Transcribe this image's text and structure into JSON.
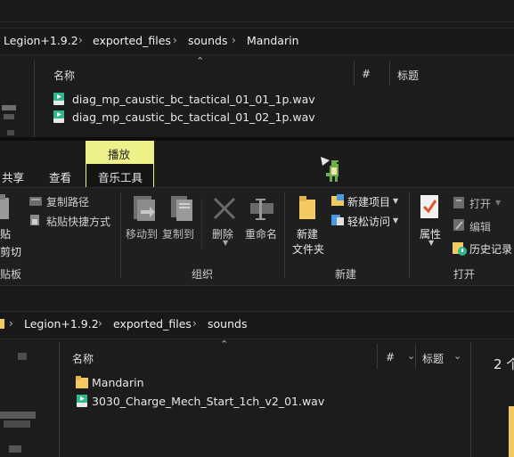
{
  "top_window": {
    "breadcrumb": [
      "Legion+1.9.2",
      "exported_files",
      "sounds",
      "Mandarin"
    ],
    "columns": {
      "name": "名称",
      "hash": "#",
      "title": "标题"
    },
    "files": [
      "diag_mp_caustic_bc_tactical_01_01_1p.wav",
      "diag_mp_caustic_bc_tactical_01_02_1p.wav"
    ]
  },
  "ribbon": {
    "context_tab_group": "播放",
    "tabs": {
      "share": "共享",
      "view": "查看",
      "music_tools": "音乐工具"
    },
    "clipboard": {
      "paste": "贴",
      "cut": "剪切",
      "copy_path": "复制路径",
      "paste_shortcut": "粘贴快捷方式",
      "group": "贴板"
    },
    "organize": {
      "move_to": "移动到",
      "copy_to": "复制到",
      "delete": "删除",
      "rename": "重命名",
      "group": "组织"
    },
    "new": {
      "new_folder_l1": "新建",
      "new_folder_l2": "文件夹",
      "new_item": "新建项目",
      "easy_access": "轻松访问",
      "group": "新建"
    },
    "open": {
      "properties": "属性",
      "open": "打开",
      "edit": "编辑",
      "history": "历史记录",
      "group": "打开"
    }
  },
  "bottom_window": {
    "breadcrumb": [
      "Legion+1.9.2",
      "exported_files",
      "sounds"
    ],
    "columns": {
      "name": "名称",
      "hash": "#",
      "title": "标题"
    },
    "items": [
      {
        "name": "Mandarin",
        "type": "folder"
      },
      {
        "name": "3030_Charge_Mech_Start_1ch_v2_01.wav",
        "type": "wav"
      }
    ],
    "status_fragment": "2 个"
  },
  "colors": {
    "context_tab_bg": "#eef08a",
    "folder": "#f3c962",
    "wav_icon": "#2fb78f"
  }
}
